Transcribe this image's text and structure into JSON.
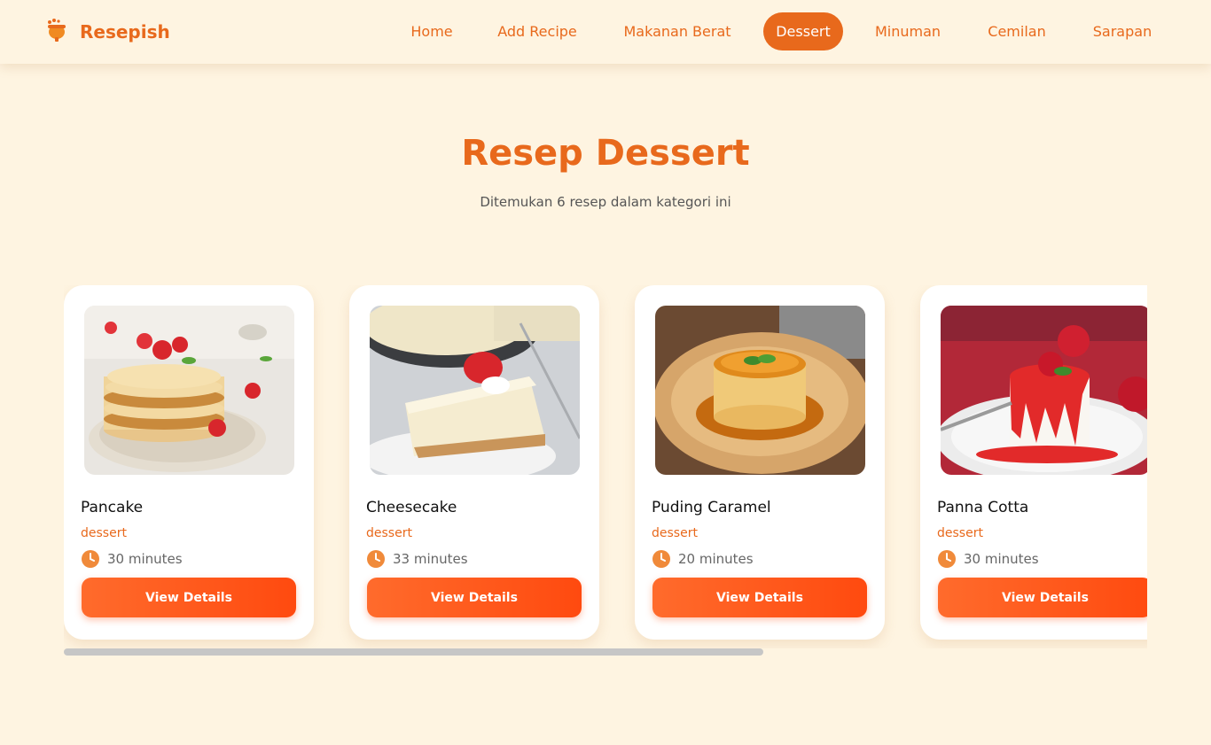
{
  "brand": {
    "name": "Resepish",
    "icon": "pot-icon",
    "color": "#e8691c"
  },
  "nav": {
    "items": [
      {
        "label": "Home",
        "active": false
      },
      {
        "label": "Add Recipe",
        "active": false
      },
      {
        "label": "Makanan Berat",
        "active": false
      },
      {
        "label": "Dessert",
        "active": true
      },
      {
        "label": "Minuman",
        "active": false
      },
      {
        "label": "Cemilan",
        "active": false
      },
      {
        "label": "Sarapan",
        "active": false
      }
    ]
  },
  "header": {
    "title": "Resep Dessert",
    "subtitle": "Ditemukan 6 resep dalam kategori ini"
  },
  "recipes": [
    {
      "name": "Pancake",
      "category": "dessert",
      "time": "30 minutes",
      "button": "View Details",
      "image": "pancake-photo"
    },
    {
      "name": "Cheesecake",
      "category": "dessert",
      "time": "33 minutes",
      "button": "View Details",
      "image": "cheesecake-photo"
    },
    {
      "name": "Puding Caramel",
      "category": "dessert",
      "time": "20 minutes",
      "button": "View Details",
      "image": "caramel-pudding-photo"
    },
    {
      "name": "Panna Cotta",
      "category": "dessert",
      "time": "30 minutes",
      "button": "View Details",
      "image": "panna-cotta-photo"
    }
  ],
  "colors": {
    "background": "#fef4e1",
    "accent": "#e8691c",
    "button_start": "#ff6b2c",
    "button_end": "#ff4a0f"
  }
}
